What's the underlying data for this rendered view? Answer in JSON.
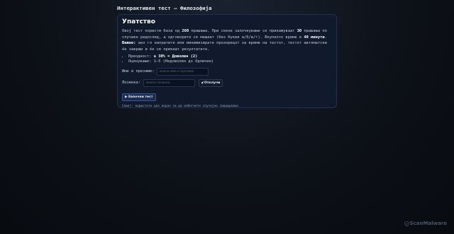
{
  "page": {
    "title": "Интерактивен тест — Филозофија"
  },
  "instructions": {
    "heading": "Упатство",
    "intro": {
      "p1": "Овој тест користи база од ",
      "total_questions": "260",
      "p2": " прашања. При секое започнување се прикажуваат ",
      "shown_questions": "30",
      "p3": " прашања по случаен редослед, а одговорите се мешаат (без букви а/б/в/г). Вкупното време е ",
      "time_limit": "40 минути",
      "p4": ". ",
      "important_label": "Важно:",
      "p5": " ако го напуштите или минимизирате прозорецот за време на тестот, тестот автоматски ќе заврши и ќе се прикаат резултатите."
    },
    "rules": [
      {
        "prefix": "Преодност: ",
        "bold": "≥ 30% = Доволен (2)",
        "suffix": ""
      },
      {
        "prefix": "Оценување: 1–5 (Недоволен до Одличен)",
        "bold": "",
        "suffix": ""
      }
    ]
  },
  "form": {
    "name_label": "Име и презиме:",
    "name_placeholder": "Внеси име и презиме",
    "name_value": "",
    "password_label": "Лозинка:",
    "password_placeholder": "Внеси лозинка",
    "password_value": "",
    "unlock_icon": "lock-icon",
    "unlock_label": "Отклучи",
    "start_icon": "play-icon",
    "start_label": "Започни тест"
  },
  "tip": "Совет: користете цел екран за да избегнете случајно завршување.",
  "brand": {
    "name": "ScanMalware",
    "icon": "shield-icon"
  },
  "colors": {
    "background": "#0d1118",
    "card": "#101a2c",
    "card_border": "#26324a",
    "accent_button": "#1e2d4d",
    "text": "#c4ccd8",
    "heading": "#ffffff"
  }
}
